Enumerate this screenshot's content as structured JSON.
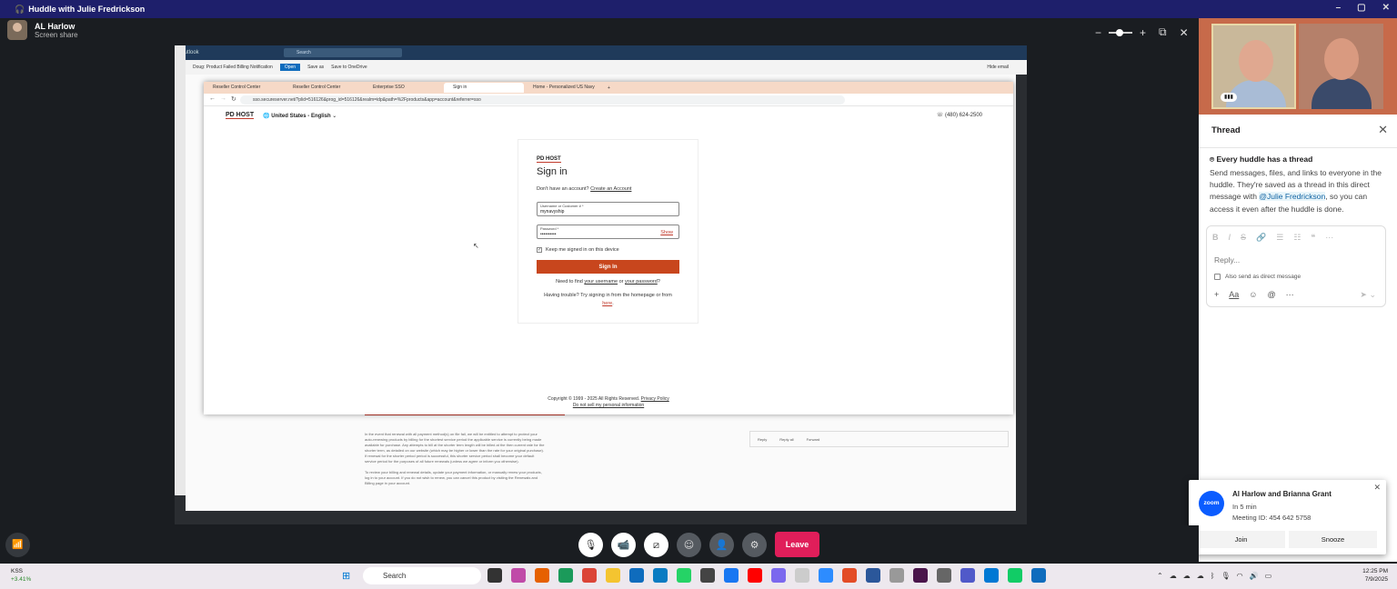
{
  "window": {
    "title": "Huddle with Julie Fredrickson",
    "controls": [
      "–",
      "▢",
      "✕"
    ]
  },
  "presenter": {
    "name": "AL Harlow",
    "status": "Screen share"
  },
  "outlook": {
    "app": "Outlook",
    "search": "Search",
    "subject": "Doug: Product Failed Billing Notification",
    "open": "Open",
    "save_as": "Save as",
    "save_onedrive": "Save to OneDrive",
    "hide_email": "Hide email",
    "email_lines": [
      "In the event that renewal with all payment method(s) on file fail, we will be entitled to attempt to protect your",
      "auto-renewing products by billing for the shortest service period the applicable service is currently being made",
      "available for purchase. Any attempts to bill at the shorter term length will be billed at the then current rate for the",
      "shorter term, as detailed on our website (which may be higher or lower than the rate for your original purchase).",
      "If renewal for the shorter period period is successful, this shorter service period shall become your default",
      "service period for the purposes of all future renewals (unless we agree or inform you otherwise).",
      "To review your billing and renewal details, update your payment information, or manually renew your products,",
      "log in to your account. If you do not wish to renew, you can cancel this product by visiting the Renewals and",
      "Billing page in your account."
    ],
    "reply": "Reply",
    "reply_all": "Reply all",
    "forward": "Forward"
  },
  "browser": {
    "tabs": [
      "Reseller Control Center",
      "Reseller Control Center",
      "Enterprise SSO",
      "Sign in",
      "Home - Personalized US Navy"
    ],
    "active_tab": 3,
    "url": "sso.secureserver.net/?plid=516126&prog_id=516126&realm=idp&path=%2Fproducts&app=account&referrer=sso"
  },
  "signin": {
    "logo": "PD HOST",
    "region": "United States - English",
    "phone": "(480) 624-2500",
    "title": "Sign in",
    "no_account": "Don't have an account?",
    "create_account": "Create an Account",
    "username_label": "Username or Customer # *",
    "username_value": "mynavyship",
    "password_label": "Password *",
    "password_value": "••••••••••",
    "show": "Show",
    "keep_signed": "Keep me signed in on this device",
    "signin_button": "Sign In",
    "find_pre": "Need to find",
    "find_user": "your username",
    "find_or": "or",
    "find_pass": "your password",
    "trouble": "Having trouble? Try signing in from the homepage or from",
    "here": "here",
    "copyright": "Copyright © 1999 - 2025 All Rights Reserved.",
    "privacy": "Privacy Policy",
    "do_not_sell": "Do not sell my personal information"
  },
  "thread": {
    "title": "Thread",
    "heading": "Every huddle has a thread",
    "body_pre": "Send messages, files, and links to everyone in the huddle. They're saved as a thread in this direct message with",
    "mention": "@Julie Fredrickson",
    "body_post": ", so you can access it even after the huddle is done.",
    "reply_placeholder": "Reply...",
    "also_send": "Also send as direct message"
  },
  "notification": {
    "logo": "zoom",
    "title": "Al Harlow and Brianna Grant",
    "time": "In 5 min",
    "meeting_id": "Meeting ID: 454 642 5758",
    "join": "Join",
    "snooze": "Snooze"
  },
  "controls": {
    "leave": "Leave"
  },
  "taskbar": {
    "stock_name": "KSS",
    "stock_change": "+3.41%",
    "search": "Search",
    "time": "12:25 PM",
    "date": "7/9/2025"
  }
}
